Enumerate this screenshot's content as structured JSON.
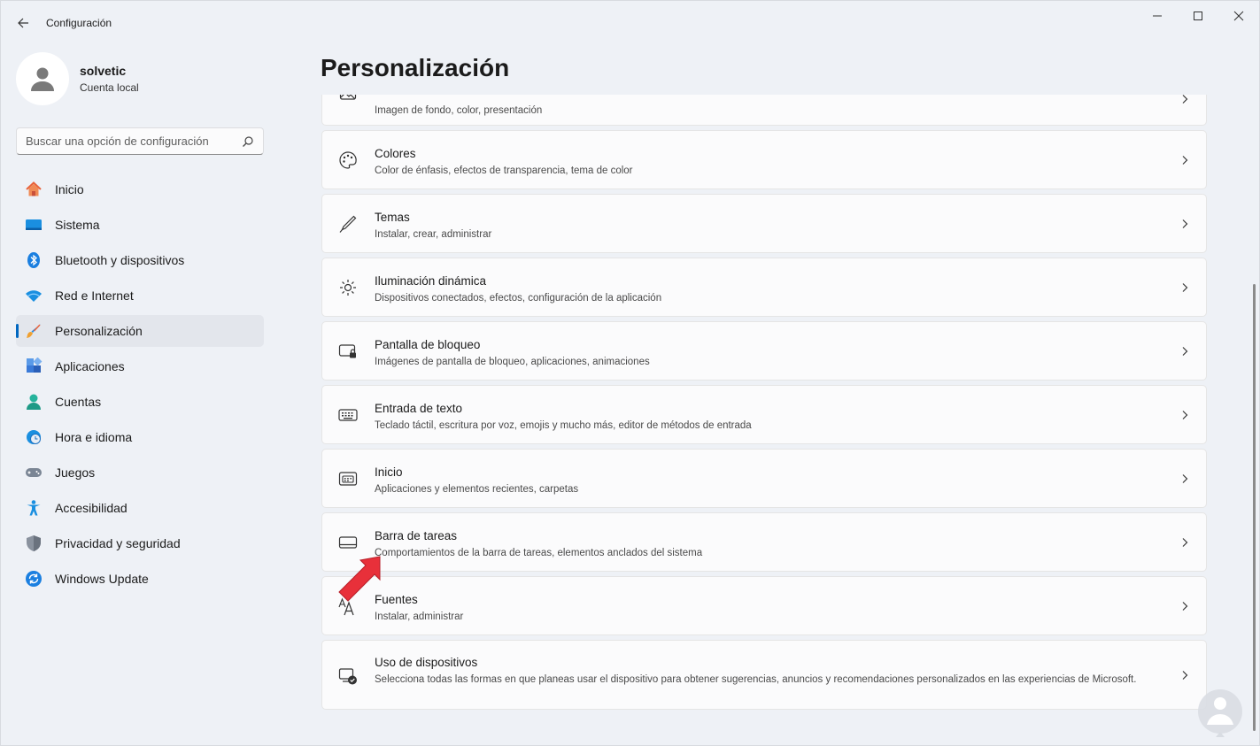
{
  "window": {
    "title": "Configuración"
  },
  "profile": {
    "name": "solvetic",
    "account_type": "Cuenta local"
  },
  "search": {
    "placeholder": "Buscar una opción de configuración"
  },
  "nav": {
    "items": [
      {
        "label": "Inicio",
        "icon": "home-icon"
      },
      {
        "label": "Sistema",
        "icon": "system-icon"
      },
      {
        "label": "Bluetooth y dispositivos",
        "icon": "bluetooth-icon"
      },
      {
        "label": "Red e Internet",
        "icon": "wifi-icon"
      },
      {
        "label": "Personalización",
        "icon": "brush-icon",
        "active": true
      },
      {
        "label": "Aplicaciones",
        "icon": "apps-icon"
      },
      {
        "label": "Cuentas",
        "icon": "account-icon"
      },
      {
        "label": "Hora e idioma",
        "icon": "clock-globe-icon"
      },
      {
        "label": "Juegos",
        "icon": "gamepad-icon"
      },
      {
        "label": "Accesibilidad",
        "icon": "accessibility-icon"
      },
      {
        "label": "Privacidad y seguridad",
        "icon": "shield-icon"
      },
      {
        "label": "Windows Update",
        "icon": "update-icon"
      }
    ]
  },
  "main": {
    "title": "Personalización",
    "cards": [
      {
        "title": "",
        "desc": "Imagen de fondo, color, presentación",
        "icon": "image-icon"
      },
      {
        "title": "Colores",
        "desc": "Color de énfasis, efectos de transparencia, tema de color",
        "icon": "palette-icon"
      },
      {
        "title": "Temas",
        "desc": "Instalar, crear, administrar",
        "icon": "pen-icon"
      },
      {
        "title": "Iluminación dinámica",
        "desc": "Dispositivos conectados, efectos, configuración de la aplicación",
        "icon": "light-icon"
      },
      {
        "title": "Pantalla de bloqueo",
        "desc": "Imágenes de pantalla de bloqueo, aplicaciones, animaciones",
        "icon": "lock-screen-icon"
      },
      {
        "title": "Entrada de texto",
        "desc": "Teclado táctil, escritura por voz, emojis y mucho más, editor de métodos de entrada",
        "icon": "keyboard-icon"
      },
      {
        "title": "Inicio",
        "desc": "Aplicaciones y elementos recientes, carpetas",
        "icon": "start-icon"
      },
      {
        "title": "Barra de tareas",
        "desc": "Comportamientos de la barra de tareas, elementos anclados del sistema",
        "icon": "taskbar-icon"
      },
      {
        "title": "Fuentes",
        "desc": "Instalar, administrar",
        "icon": "font-icon"
      },
      {
        "title": "Uso de dispositivos",
        "desc": "Selecciona todas las formas en que planeas usar el dispositivo para obtener sugerencias, anuncios y recomendaciones personalizados en las experiencias de Microsoft.",
        "icon": "device-usage-icon"
      }
    ]
  },
  "colors": {
    "accent": "#0067c0",
    "annotation_arrow": "#e8303a"
  }
}
